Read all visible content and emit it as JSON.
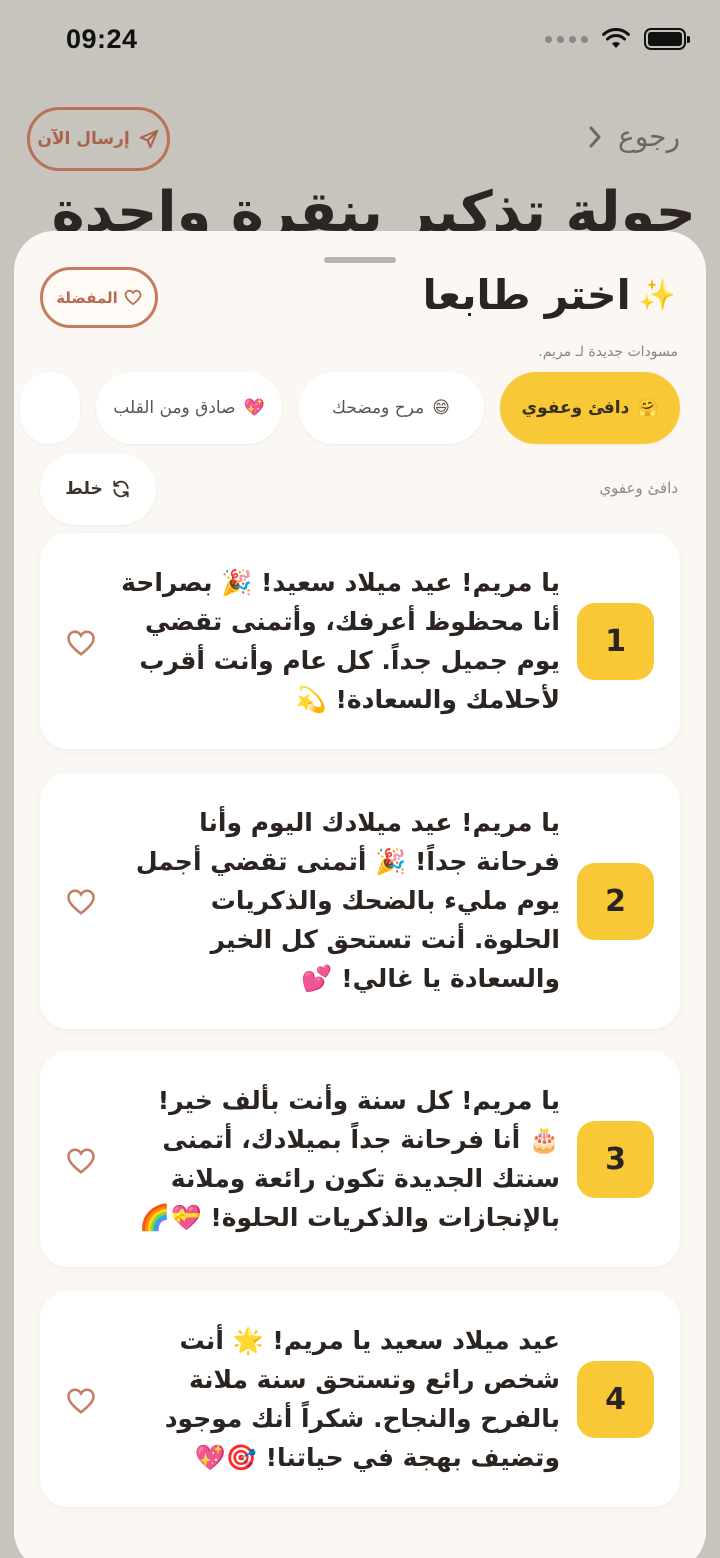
{
  "status_bar": {
    "time": "09:24"
  },
  "background": {
    "back_label": "رجوع",
    "send_label": "إرسال الآن",
    "title": "جولة تذكير بنقرة واحدة"
  },
  "sheet": {
    "title": "اختر طابعا",
    "subtitle": "مسودات جديدة لـ مريم.",
    "favorites_label": "المفضلة",
    "tones": [
      {
        "emoji": "🤗",
        "label": "دافئ وعفوي"
      },
      {
        "emoji": "😄",
        "label": "مرح ومضحك"
      },
      {
        "emoji": "💖",
        "label": "صادق ومن القلب"
      }
    ],
    "current_tone": "دافئ وعفوي",
    "shuffle_label": "خلط",
    "messages": [
      {
        "number": "1",
        "text": "يا مريم! عيد ميلاد سعيد! 🎉 بصراحة أنا محظوظ أعرفك، وأتمنى تقضي يوم جميل جداً. كل عام وأنت أقرب لأحلامك والسعادة! 💫"
      },
      {
        "number": "2",
        "text": "يا مريم! عيد ميلادك اليوم وأنا فرحانة جداً! 🎉 أتمنى تقضي أجمل يوم مليء بالضحك والذكريات الحلوة. أنت تستحق كل الخير والسعادة يا غالي! 💕"
      },
      {
        "number": "3",
        "text": "يا مريم! كل سنة وأنت بألف خير! 🎂 أنا فرحانة جداً بميلادك، أتمنى سنتك الجديدة تكون رائعة وملانة بالإنجازات والذكريات الحلوة! 💝🌈"
      },
      {
        "number": "4",
        "text": "عيد ميلاد سعيد يا مريم! 🌟 أنت شخص رائع وتستحق سنة ملانة بالفرح والنجاح. شكراً أنك موجود وتضيف بهجة في حياتنا! 🎯💖"
      }
    ]
  },
  "colors": {
    "accent": "#f8c837",
    "brand": "#c77b5f",
    "sheet_bg": "#fbf7f2"
  }
}
